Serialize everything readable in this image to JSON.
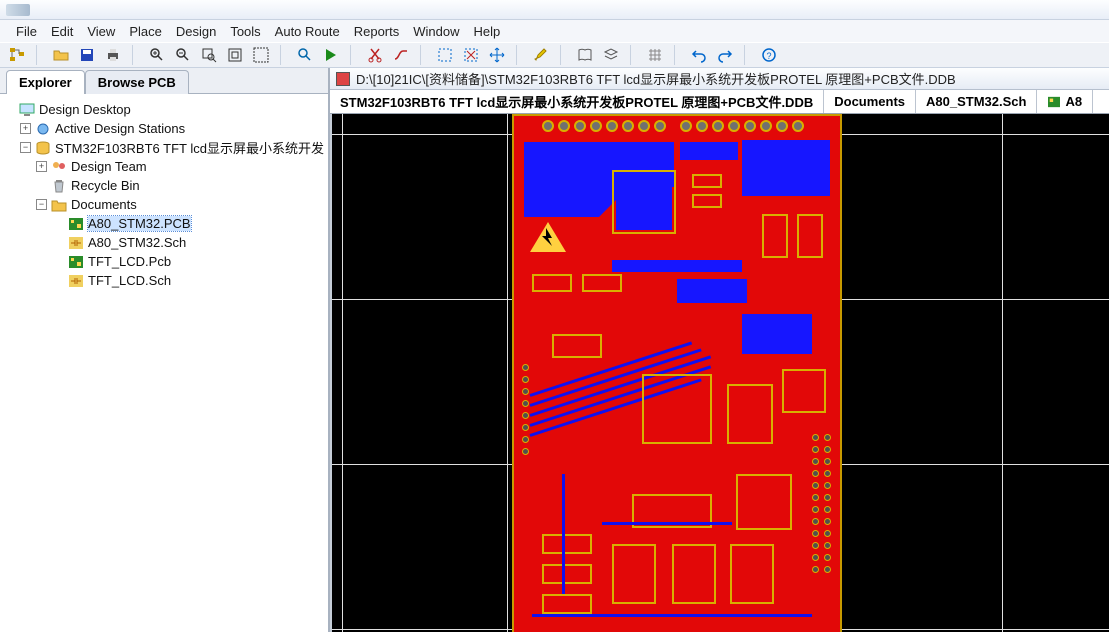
{
  "menu": [
    "File",
    "Edit",
    "View",
    "Place",
    "Design",
    "Tools",
    "Auto Route",
    "Reports",
    "Window",
    "Help"
  ],
  "sidebar": {
    "tabs": [
      "Explorer",
      "Browse PCB"
    ],
    "tree": {
      "root": "Design Desktop",
      "n1": "Active Design Stations",
      "n2": "STM32F103RBT6 TFT lcd显示屏最小系统开发",
      "n3": "Design Team",
      "n4": "Recycle Bin",
      "n5": "Documents",
      "d1": "A80_STM32.PCB",
      "d2": "A80_STM32.Sch",
      "d3": "TFT_LCD.Pcb",
      "d4": "TFT_LCD.Sch"
    }
  },
  "document": {
    "title_path": "D:\\[10]21IC\\[资料储备]\\STM32F103RBT6 TFT lcd显示屏最小系统开发板PROTEL 原理图+PCB文件.DDB",
    "tabs": {
      "t1": "STM32F103RBT6 TFT lcd显示屏最小系统开发板PROTEL 原理图+PCB文件.DDB",
      "t2": "Documents",
      "t3": "A80_STM32.Sch",
      "t4": "A8"
    }
  }
}
